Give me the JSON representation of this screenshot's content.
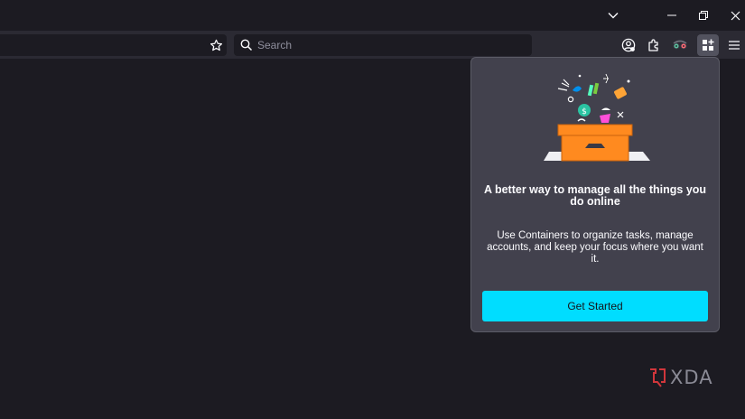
{
  "window_controls": {
    "tab_list_icon": "chevron-down-icon",
    "minimize_icon": "minimize-icon",
    "restore_icon": "restore-icon",
    "close_icon": "close-icon"
  },
  "toolbar": {
    "bookmark_icon": "star-icon",
    "search": {
      "placeholder": "Search"
    },
    "icons": [
      "account-icon",
      "extensions-icon",
      "extension-glasses-icon",
      "containers-icon",
      "menu-icon"
    ]
  },
  "containers_panel": {
    "title": "A better way to manage all the things you do online",
    "description": "Use Containers to organize tasks, manage accounts, and keep your focus where you want it.",
    "button_label": "Get Started",
    "colors": {
      "panel_bg": "#42414d",
      "button_bg": "#00ddff",
      "box_orange": "#ff8a1f"
    }
  },
  "watermark": {
    "text": "XDA"
  }
}
